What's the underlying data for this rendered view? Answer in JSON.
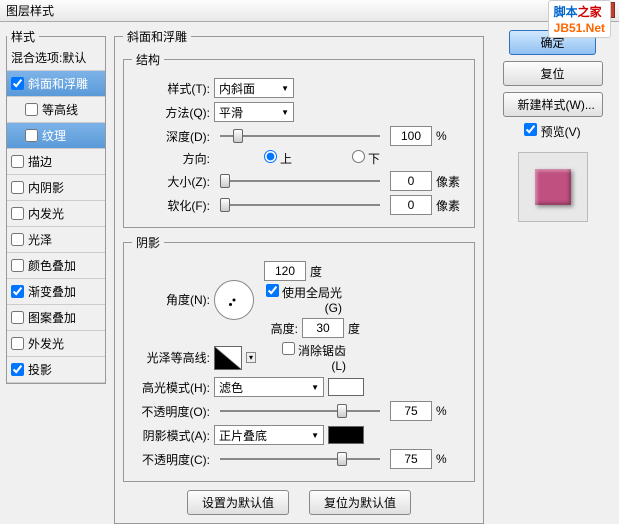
{
  "window": {
    "title": "图层样式"
  },
  "watermark": {
    "text1": "脚本",
    "text2": "之家",
    "domain": "JB51.Net"
  },
  "sidebar": {
    "header": "样式",
    "blend": "混合选项:默认",
    "items": [
      {
        "label": "斜面和浮雕",
        "checked": true,
        "selected": true
      },
      {
        "label": "等高线",
        "checked": false,
        "sub": true
      },
      {
        "label": "纹理",
        "checked": false,
        "sub": true,
        "selected": true
      },
      {
        "label": "描边",
        "checked": false
      },
      {
        "label": "内阴影",
        "checked": false
      },
      {
        "label": "内发光",
        "checked": false
      },
      {
        "label": "光泽",
        "checked": false
      },
      {
        "label": "颜色叠加",
        "checked": false
      },
      {
        "label": "渐变叠加",
        "checked": true
      },
      {
        "label": "图案叠加",
        "checked": false
      },
      {
        "label": "外发光",
        "checked": false
      },
      {
        "label": "投影",
        "checked": true
      }
    ]
  },
  "bevel": {
    "group_title": "斜面和浮雕",
    "structure_title": "结构",
    "style_label": "样式(T):",
    "style_value": "内斜面",
    "technique_label": "方法(Q):",
    "technique_value": "平滑",
    "depth_label": "深度(D):",
    "depth_value": "100",
    "depth_unit": "%",
    "direction_label": "方向:",
    "up": "上",
    "down": "下",
    "size_label": "大小(Z):",
    "size_value": "0",
    "size_unit": "像素",
    "soften_label": "软化(F):",
    "soften_value": "0",
    "soften_unit": "像素",
    "shading_title": "阴影",
    "angle_label": "角度(N):",
    "angle_value": "120",
    "angle_unit": "度",
    "global_light": "使用全局光(G)",
    "altitude_label": "高度:",
    "altitude_value": "30",
    "altitude_unit": "度",
    "gloss_label": "光泽等高线:",
    "antialias": "消除锯齿(L)",
    "highlight_mode_label": "高光模式(H):",
    "highlight_mode_value": "滤色",
    "highlight_opacity_label": "不透明度(O):",
    "highlight_opacity_value": "75",
    "opacity_unit": "%",
    "shadow_mode_label": "阴影模式(A):",
    "shadow_mode_value": "正片叠底",
    "shadow_opacity_label": "不透明度(C):",
    "shadow_opacity_value": "75",
    "make_default": "设置为默认值",
    "reset_default": "复位为默认值"
  },
  "buttons": {
    "ok": "确定",
    "cancel": "复位",
    "new_style": "新建样式(W)...",
    "preview": "预览(V)"
  }
}
